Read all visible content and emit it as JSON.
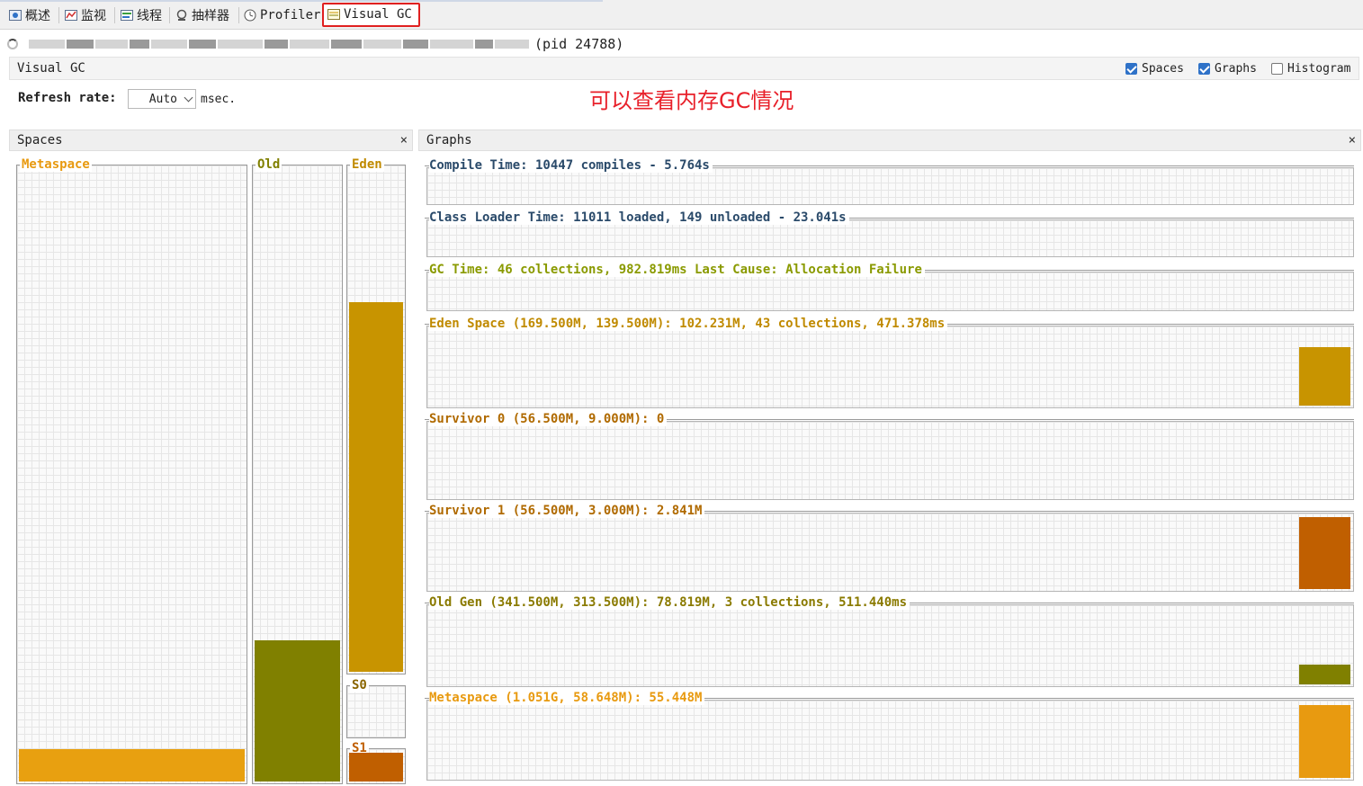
{
  "tabs": [
    {
      "label": "概述",
      "icon": "overview-icon"
    },
    {
      "label": "监视",
      "icon": "monitor-chart-icon"
    },
    {
      "label": "线程",
      "icon": "threads-icon"
    },
    {
      "label": "抽样器",
      "icon": "sampler-icon"
    },
    {
      "label": "Profiler",
      "icon": "profiler-clock-icon"
    },
    {
      "label": "Visual GC",
      "icon": "visual-gc-icon",
      "selected": true
    }
  ],
  "process": {
    "pid_text": "(pid 24788)"
  },
  "header": {
    "title": "Visual GC",
    "checkboxes": [
      {
        "label": "Spaces",
        "checked": true
      },
      {
        "label": "Graphs",
        "checked": true
      },
      {
        "label": "Histogram",
        "checked": false
      }
    ]
  },
  "refresh": {
    "label": "Refresh rate:",
    "value": "Auto",
    "unit": "msec."
  },
  "annotation": "可以查看内存GC情况",
  "spaces_panel": {
    "title": "Spaces",
    "close": "×",
    "items": [
      {
        "label": "Metaspace",
        "used_fraction": 0.053,
        "color": "#e8a010",
        "label_color": "#e89a10"
      },
      {
        "label": "Old",
        "used_fraction": 0.23,
        "color": "#808000",
        "label_color": "#808000"
      },
      {
        "label": "Eden",
        "used_fraction": 0.733,
        "color": "#c89400",
        "label_color": "#c08a00"
      },
      {
        "label": "S0",
        "used_fraction": 0.0,
        "color": "#c05f00",
        "label_color": "#8a6500"
      },
      {
        "label": "S1",
        "used_fraction": 0.947,
        "color": "#c05f00",
        "label_color": "#c05f00"
      }
    ]
  },
  "graphs_panel": {
    "title": "Graphs",
    "close": "×",
    "rows": [
      {
        "title": "Compile Time: 10447 compiles - 5.764s",
        "color": "#2a4a6a",
        "level": 0
      },
      {
        "title": "Class Loader Time: 11011 loaded, 149 unloaded - 23.041s",
        "color": "#2a4a6a",
        "level": 0
      },
      {
        "title": "GC Time: 46 collections, 982.819ms Last Cause: Allocation Failure",
        "color": "#8a9a00",
        "level": 0
      },
      {
        "title": "Eden Space (169.500M, 139.500M): 102.231M, 43 collections, 471.378ms",
        "color": "#c08a00",
        "fill": "#c89400",
        "level": 0.733
      },
      {
        "title": "Survivor 0 (56.500M, 9.000M): 0",
        "color": "#b06a00",
        "fill": "#c05f00",
        "level": 0
      },
      {
        "title": "Survivor 1 (56.500M, 3.000M): 2.841M",
        "color": "#b06a00",
        "fill": "#c05f00",
        "level": 0.947
      },
      {
        "title": "Old Gen (341.500M, 313.500M): 78.819M, 3 collections, 511.440ms",
        "color": "#8a7a00",
        "fill": "#808000",
        "level": 0.25
      },
      {
        "title": "Metaspace (1.051G, 58.648M): 55.448M",
        "color": "#e89a10",
        "fill": "#e89a10",
        "level": 0.945
      }
    ]
  }
}
